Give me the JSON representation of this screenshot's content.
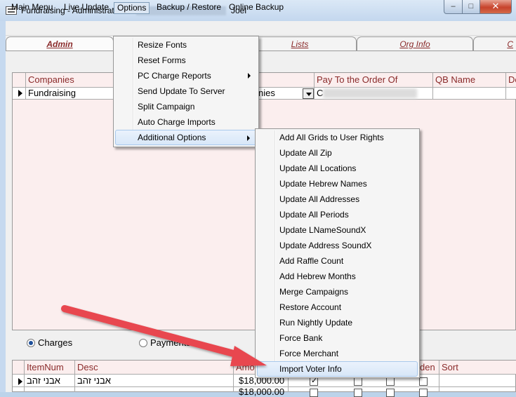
{
  "window": {
    "title": "Fundraising - Administration -",
    "user": "Joel",
    "controls": {
      "minimize": "–",
      "maximize": "□",
      "close": "✕"
    }
  },
  "menubar": [
    "Main Menu",
    "Live Update",
    "Options",
    "Backup / Restore",
    "Online Backup"
  ],
  "tabs": [
    "Admin",
    "Lists",
    "Org Info",
    "C"
  ],
  "companies_grid": {
    "headers": [
      "Companies",
      "Pay To the Order Of",
      "QB Name",
      "De"
    ],
    "row": {
      "name": "Fundraising",
      "mid": "nies",
      "payto": "C"
    }
  },
  "radios": {
    "charges": "Charges",
    "payments": "Payments",
    "selected": "charges"
  },
  "charges_grid": {
    "headers": [
      "ItemNum",
      "Desc",
      "Amo",
      "den",
      "Sort"
    ],
    "rows": [
      {
        "item": "אבני זהב",
        "desc": "אבני זהב",
        "amount": "$18,000.00"
      },
      {
        "item": "",
        "desc": "",
        "amount": "$18,000.00"
      }
    ]
  },
  "options_menu": [
    {
      "label": "Resize Fonts",
      "submenu": false
    },
    {
      "label": "Reset Forms",
      "submenu": false
    },
    {
      "label": "PC Charge Reports",
      "submenu": true
    },
    {
      "label": "Send Update To Server",
      "submenu": false
    },
    {
      "label": "Split Campaign",
      "submenu": false
    },
    {
      "label": "Auto Charge Imports",
      "submenu": false
    },
    {
      "label": "Additional Options",
      "submenu": true
    }
  ],
  "additional_options_menu": [
    "Add All Grids to User Rights",
    "Update All Zip",
    "Update All Locations",
    "Update Hebrew Names",
    "Update All Addresses",
    "Update All Periods",
    "Update LNameSoundX",
    "Update Address SoundX",
    "Add Raffle Count",
    "Add Hebrew Months",
    "Merge Campaigns",
    "Restore Account",
    "Run Nightly Update",
    "Force Bank",
    "Force Merchant",
    "Import Voter Info"
  ],
  "colors": {
    "header_text": "#8a2a2a",
    "grid_bg": "#fbeeee",
    "annotation_arrow": "#e8474f",
    "close_button": "#c7432c"
  }
}
